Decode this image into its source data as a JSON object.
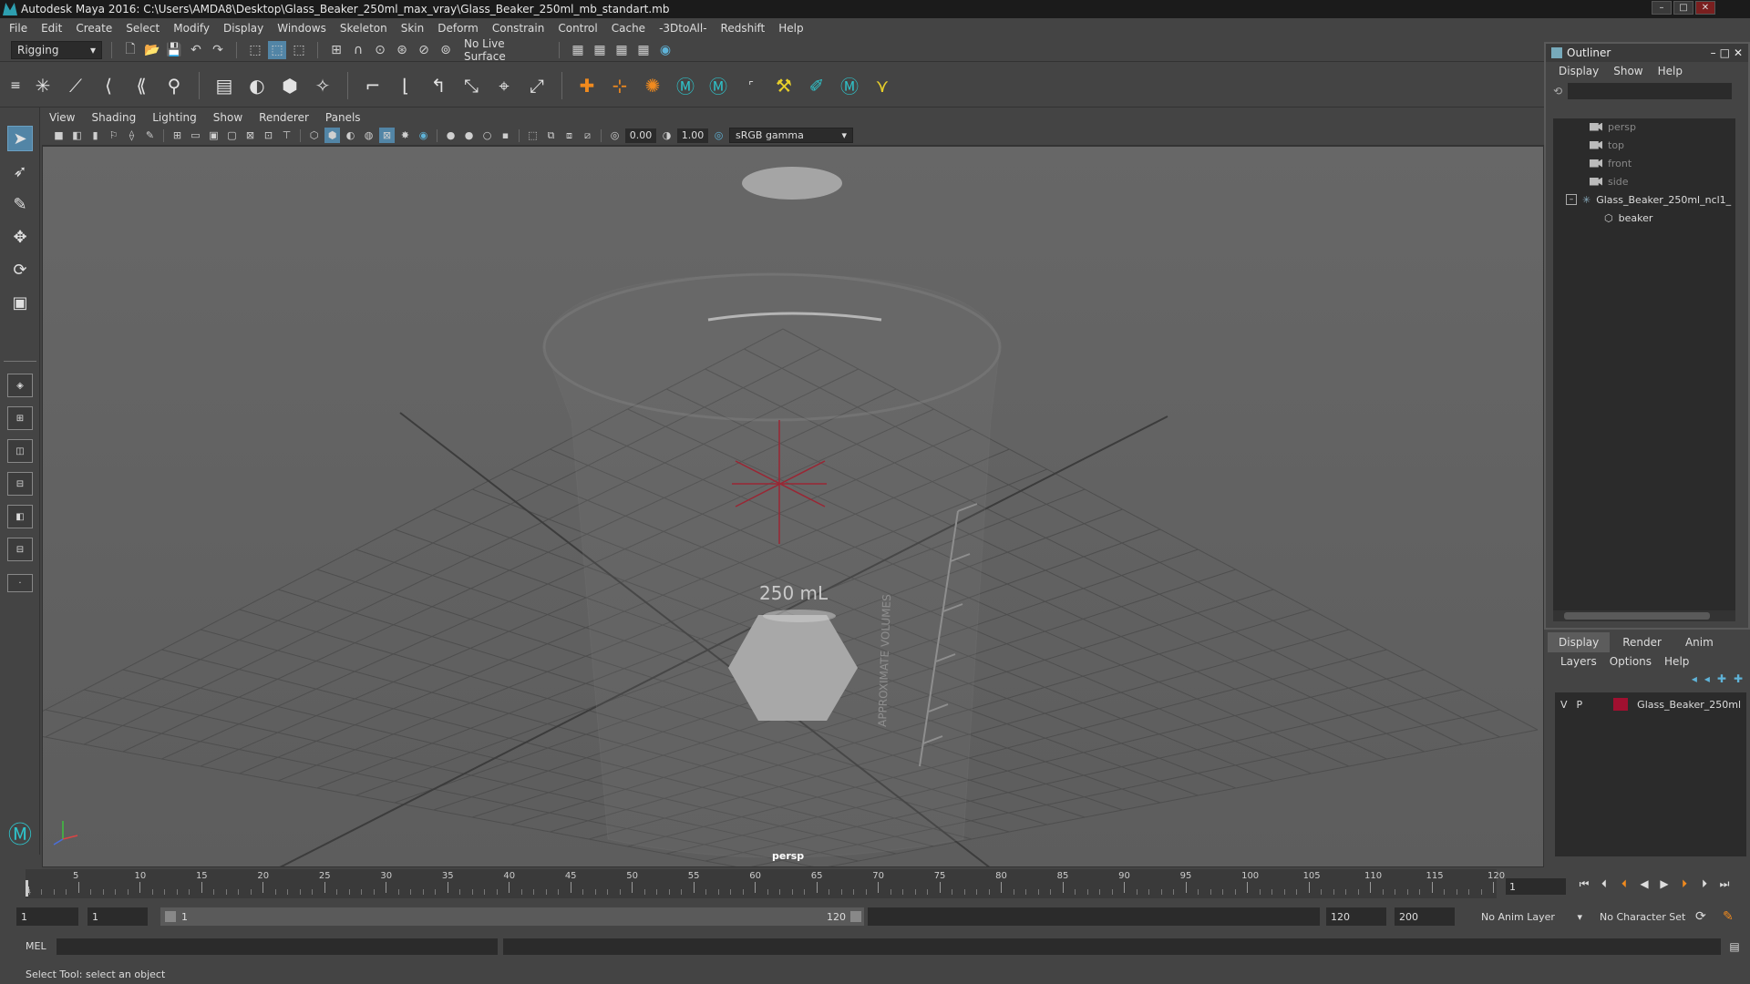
{
  "window": {
    "title": "Autodesk Maya 2016: C:\\Users\\AMDA8\\Desktop\\Glass_Beaker_250ml_max_vray\\Glass_Beaker_250ml_mb_standart.mb"
  },
  "menubar": [
    "File",
    "Edit",
    "Create",
    "Select",
    "Modify",
    "Display",
    "Windows",
    "Skeleton",
    "Skin",
    "Deform",
    "Constrain",
    "Control",
    "Cache",
    "-3DtoAll-",
    "Redshift",
    "Help"
  ],
  "statusline": {
    "mode": "Rigging",
    "live_surface": "No Live Surface"
  },
  "panel": {
    "menus": [
      "View",
      "Shading",
      "Lighting",
      "Show",
      "Renderer",
      "Panels"
    ],
    "exposure": "0.00",
    "gamma": "1.00",
    "color_space": "sRGB gamma",
    "camera": "persp"
  },
  "scene": {
    "beaker_label": "250 mL",
    "side_text": "APPROXIMATE VOLUMES"
  },
  "outliner": {
    "title": "Outliner",
    "menus": [
      "Display",
      "Show",
      "Help"
    ],
    "items": [
      {
        "label": "persp"
      },
      {
        "label": "top"
      },
      {
        "label": "front"
      },
      {
        "label": "side"
      },
      {
        "label": "Glass_Beaker_250ml_ncl1_"
      },
      {
        "label": "beaker"
      }
    ]
  },
  "layer_editor": {
    "tabs": [
      "Display",
      "Render",
      "Anim"
    ],
    "menus": [
      "Layers",
      "Options",
      "Help"
    ],
    "layer": {
      "v": "V",
      "p": "P",
      "name": "Glass_Beaker_250ml",
      "color": "#a01030"
    }
  },
  "timeline": {
    "ticks": [
      "5",
      "10",
      "15",
      "20",
      "25",
      "30",
      "35",
      "40",
      "45",
      "50",
      "55",
      "60",
      "65",
      "70",
      "75",
      "80",
      "85",
      "90",
      "95",
      "100",
      "105",
      "110",
      "115",
      "120"
    ],
    "start_marker": "1",
    "current_frame": "1"
  },
  "range": {
    "start": "1",
    "anim_start": "1",
    "range_start": "1",
    "range_end": "120",
    "anim_end": "120",
    "end": "200",
    "anim_layer": "No Anim Layer",
    "char_set": "No Character Set"
  },
  "cmd": {
    "lang": "MEL"
  },
  "help": {
    "text": "Select Tool: select an object"
  }
}
